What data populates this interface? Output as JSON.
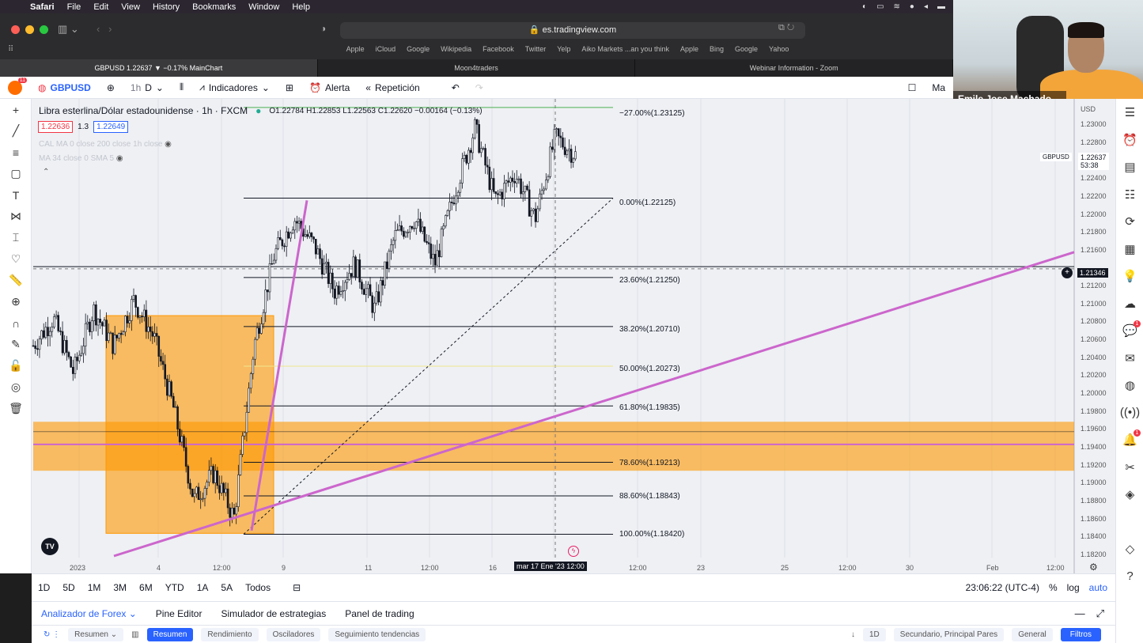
{
  "menubar": {
    "app": "Safari",
    "items": [
      "File",
      "Edit",
      "View",
      "History",
      "Bookmarks",
      "Window",
      "Help"
    ]
  },
  "safari": {
    "address": "es.tradingview.com",
    "favorites": [
      "Apple",
      "iCloud",
      "Google",
      "Wikipedia",
      "Facebook",
      "Twitter",
      "Yelp",
      "Aiko Markets ...an you think",
      "Apple",
      "Bing",
      "Google",
      "Yahoo"
    ],
    "tabs": [
      {
        "label": "GBPUSD 1.22637 ▼ −0.17% MainChart",
        "active": true
      },
      {
        "label": "Moon4traders",
        "active": false
      },
      {
        "label": "Webinar Information - Zoom",
        "active": false
      }
    ]
  },
  "webcam": {
    "name": "Emile Jose Machado ..."
  },
  "toolbar": {
    "symbol": "GBPUSD",
    "interval": "1h",
    "interval2": "D",
    "indicators": "Indicadores",
    "alert": "Alerta",
    "replay": "Repetición",
    "notif_count": "11",
    "cut_label": "Ma"
  },
  "legend": {
    "title": "Libra esterlina/Dólar estadounidense · 1h · FXCM",
    "o_label": "O",
    "o": "1.22784",
    "h_label": "H",
    "h": "1.22853",
    "l_label": "L",
    "l": "1.22563",
    "c_label": "C",
    "c": "1.22620",
    "change": "−0.00164 (−0.13%)",
    "bid": "1.22636",
    "spread": "1.3",
    "ask": "1.22649",
    "ind1": "CAL MA 0 close 200 close 1h close",
    "ind2": "MA 34 close 0 SMA 5"
  },
  "fib": [
    {
      "label": "−27.00%(1.23125)",
      "color": "#4caf50"
    },
    {
      "label": "0.00%(1.22125)",
      "color": "#131722"
    },
    {
      "label": "23.60%(1.21250)",
      "color": "#131722"
    },
    {
      "label": "38.20%(1.20710)",
      "color": "#131722"
    },
    {
      "label": "50.00%(1.20273)",
      "color": "#f0e68c"
    },
    {
      "label": "61.80%(1.19835)",
      "color": "#131722"
    },
    {
      "label": "78.60%(1.19213)",
      "color": "#131722"
    },
    {
      "label": "88.60%(1.18843)",
      "color": "#131722"
    },
    {
      "label": "100.00%(1.18420)",
      "color": "#131722"
    }
  ],
  "price_axis": {
    "currency": "USD",
    "labels": [
      "1.23000",
      "1.22800",
      "1.22600",
      "1.22400",
      "1.22200",
      "1.22000",
      "1.21800",
      "1.21600",
      "1.21400",
      "1.21200",
      "1.21000",
      "1.20800",
      "1.20600",
      "1.20400",
      "1.20200",
      "1.20000",
      "1.19800",
      "1.19600",
      "1.19400",
      "1.19200",
      "1.19000",
      "1.18800",
      "1.18600",
      "1.18400",
      "1.18200"
    ],
    "ticker_badge": "GBPUSD",
    "ticker_price": "1.22637",
    "ticker_countdown": "53:38",
    "crosshair_price": "1.21346"
  },
  "time_axis": {
    "labels": [
      "2023",
      "4",
      "12:00",
      "9",
      "11",
      "12:00",
      "16",
      "12:00",
      "23",
      "25",
      "12:00",
      "30",
      "Feb",
      "12:00"
    ],
    "cursor": "mar 17 Ene '23",
    "cursor_time": "12:00"
  },
  "timeframes": [
    "1D",
    "5D",
    "1M",
    "3M",
    "6M",
    "YTD",
    "1A",
    "5A",
    "Todos"
  ],
  "status": {
    "clock": "23:06:22 (UTC-4)",
    "pct": "%",
    "log": "log",
    "auto": "auto"
  },
  "panel_tabs": [
    "Analizador de Forex",
    "Pine Editor",
    "Simulador de estrategias",
    "Panel de trading"
  ],
  "panel_row": {
    "chips": [
      "Resumen",
      "Resumen",
      "Rendimiento",
      "Osciladores",
      "Seguimiento tendencias"
    ],
    "right": [
      "1D",
      "Secundario, Principal Pares",
      "General"
    ],
    "filter": "Filtros"
  },
  "chart_data": {
    "type": "line",
    "symbol": "GBPUSD",
    "interval": "1h",
    "fib_levels": [
      {
        "pct": -27.0,
        "price": 1.23125
      },
      {
        "pct": 0.0,
        "price": 1.22125
      },
      {
        "pct": 23.6,
        "price": 1.2125
      },
      {
        "pct": 38.2,
        "price": 1.2071
      },
      {
        "pct": 50.0,
        "price": 1.20273
      },
      {
        "pct": 61.8,
        "price": 1.19835
      },
      {
        "pct": 78.6,
        "price": 1.19213
      },
      {
        "pct": 88.6,
        "price": 1.18843
      },
      {
        "pct": 100.0,
        "price": 1.1842
      }
    ],
    "ylim": [
      1.182,
      1.232
    ],
    "approx_close": [
      1.205,
      1.208,
      1.202,
      1.209,
      1.205,
      1.21,
      1.206,
      1.198,
      1.188,
      1.191,
      1.186,
      1.205,
      1.215,
      1.219,
      1.216,
      1.211,
      1.214,
      1.209,
      1.217,
      1.219,
      1.214,
      1.222,
      1.229,
      1.221,
      1.224,
      1.219,
      1.228,
      1.226
    ]
  }
}
